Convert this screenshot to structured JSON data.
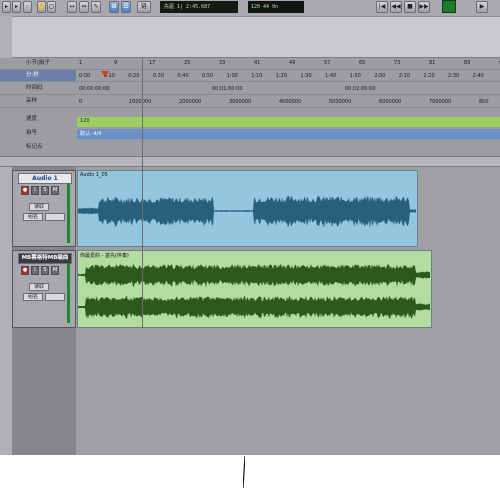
{
  "transport": {
    "counter_main": "1|  2:45.687",
    "counter_sub": "120   44   0n",
    "mode_label": "先驱",
    "tool_label": "链"
  },
  "rulers": {
    "bars_label": "小节|拍子",
    "minsec_label": "分:秒",
    "timecode_label": "时间码",
    "samples_label": "采样",
    "tempo_label": "速度",
    "meter_label": "拍号",
    "markers_label": "标记点",
    "bars_ticks": [
      "1",
      "9",
      "17",
      "25",
      "33",
      "41",
      "49",
      "57",
      "65",
      "73",
      "81",
      "89",
      "9"
    ],
    "minsec_ticks": [
      "0:00",
      "0:10",
      "0:20",
      "0:30",
      "0:40",
      "0:50",
      "1:00",
      "1:10",
      "1:20",
      "1:30",
      "1:40",
      "1:50",
      "2:00",
      "2:10",
      "2:20",
      "2:30",
      "2:40"
    ],
    "timecode_ticks": [
      "00:00:00:00",
      "00:01:00:00",
      "00:02:00:00"
    ],
    "samples_ticks": [
      "0",
      "1000000",
      "2000000",
      "3000000",
      "4000000",
      "5000000",
      "6000000",
      "7000000",
      "800"
    ],
    "tempo_value": "120",
    "meter_value": "默认: 4/4"
  },
  "tracks": [
    {
      "name": "Audio 1",
      "clip_name": "Audio 1_05",
      "read_label": "读取",
      "group_label": "组名",
      "solo_label": "S",
      "mute_label": "M",
      "input_label": "I",
      "clip_color": "#93c6df",
      "wave_color": "#285f7b"
    },
    {
      "name": "MB幂格特MB编曲",
      "clip_name": "你最爱的 - 首先(伴奏)",
      "read_label": "读取",
      "group_label": "组名",
      "solo_label": "S",
      "mute_label": "M",
      "input_label": "I",
      "clip_color": "#b3dda0",
      "wave_color": "#2b5a1c"
    }
  ],
  "colors": {
    "tempo_strip": "#9ccf62",
    "meter_strip": "#6a8fc9",
    "record": "#c0282b",
    "meter_green": "#1e8a2d"
  }
}
